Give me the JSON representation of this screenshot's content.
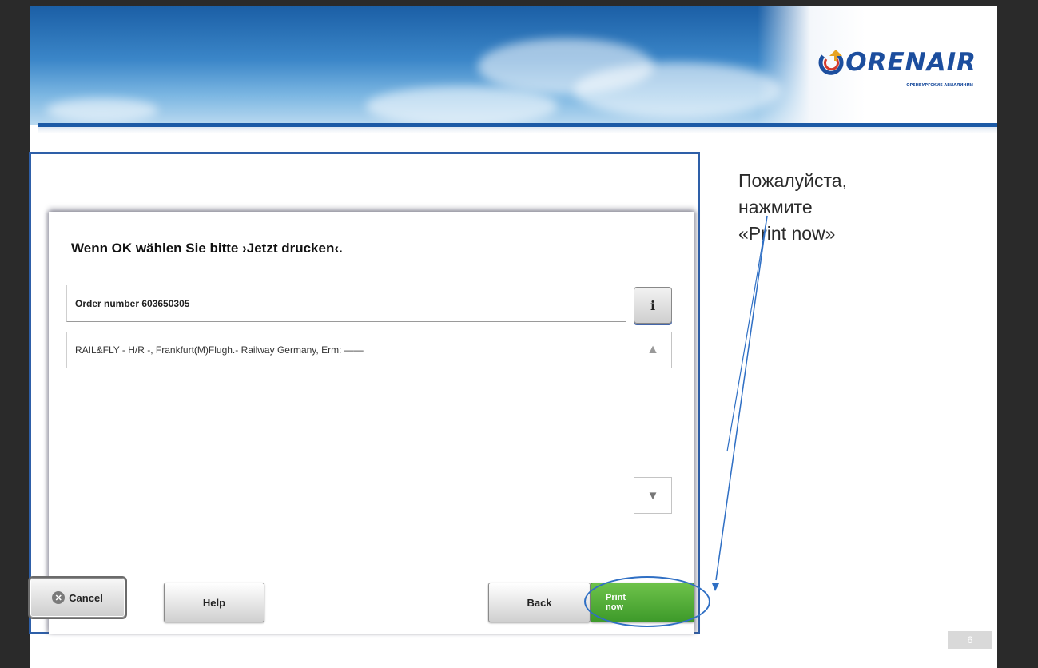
{
  "brand": {
    "logo_text": "ORENAIR",
    "logo_subtitle": "ОРЕНБУРГСКИЕ АВИАЛИНИИ"
  },
  "dialog": {
    "title": "Wenn OK wählen Sie bitte ›Jetzt drucken‹.",
    "rows": [
      {
        "text": "Order number 603650305"
      },
      {
        "text": "RAIL&FLY - H/R -, Frankfurt(M)Flugh.- Railway Germany, Erm: ——"
      }
    ],
    "info_label": "i",
    "up_label": "▲",
    "down_label": "▼"
  },
  "buttons": {
    "cancel": "Cancel",
    "cancel_icon": "✕",
    "help": "Help",
    "back": "Back",
    "print_line1": "Print",
    "print_line2": "now"
  },
  "instruction": {
    "line1": "Пожалуйста,",
    "line2": "нажмите",
    "line3": "«Print now»"
  },
  "page_number": "6",
  "colors": {
    "accent_blue": "#2e5fa8",
    "print_green": "#4ea634"
  }
}
